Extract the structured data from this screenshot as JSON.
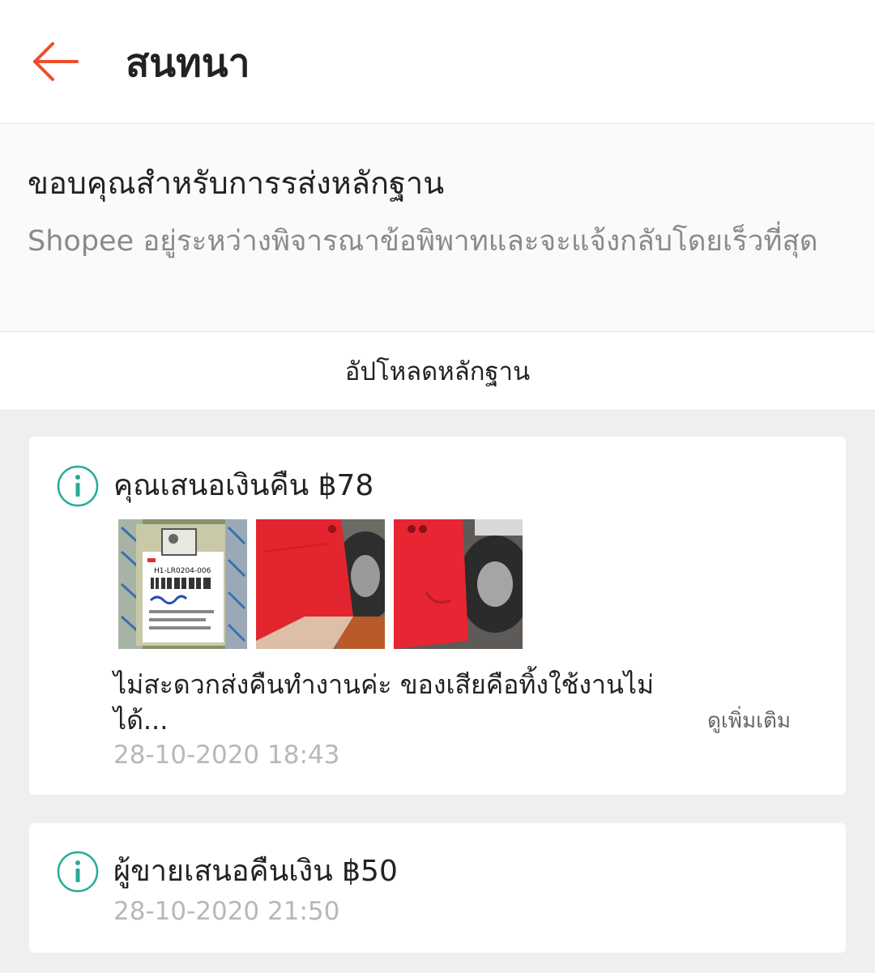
{
  "header": {
    "title": "สนทนา",
    "back_icon": "arrow-left-icon"
  },
  "notice": {
    "title": "ขอบคุณสำหรับการรส่งหลักฐาน",
    "description": "Shopee อยู่ระหว่างพิจารณาข้อพิพาทและจะแจ้งกลับโดยเร็วที่สุด"
  },
  "upload": {
    "label": "อัปโหลดหลักฐาน"
  },
  "timeline": [
    {
      "title": "คุณเสนอเงินคืน ฿78",
      "icon": "info-icon",
      "photos": [
        "shipping-label-photo",
        "red-case-photo-1",
        "red-case-photo-2"
      ],
      "photo_label_text": "H1-LR0204-006",
      "message": "ไม่สะดวกส่งคืนทำงานค่ะ ของเสียคือทิ้งใช้งานไม่ได้...",
      "see_more": "ดูเพิ่มเติม",
      "time": "28-10-2020 18:43"
    },
    {
      "title": "ผู้ขายเสนอคืนเงิน ฿50",
      "icon": "info-icon",
      "time": "28-10-2020 21:50"
    }
  ],
  "colors": {
    "accent": "#ee4d2d",
    "info": "#26aa99",
    "muted": "#b8b8b8"
  }
}
